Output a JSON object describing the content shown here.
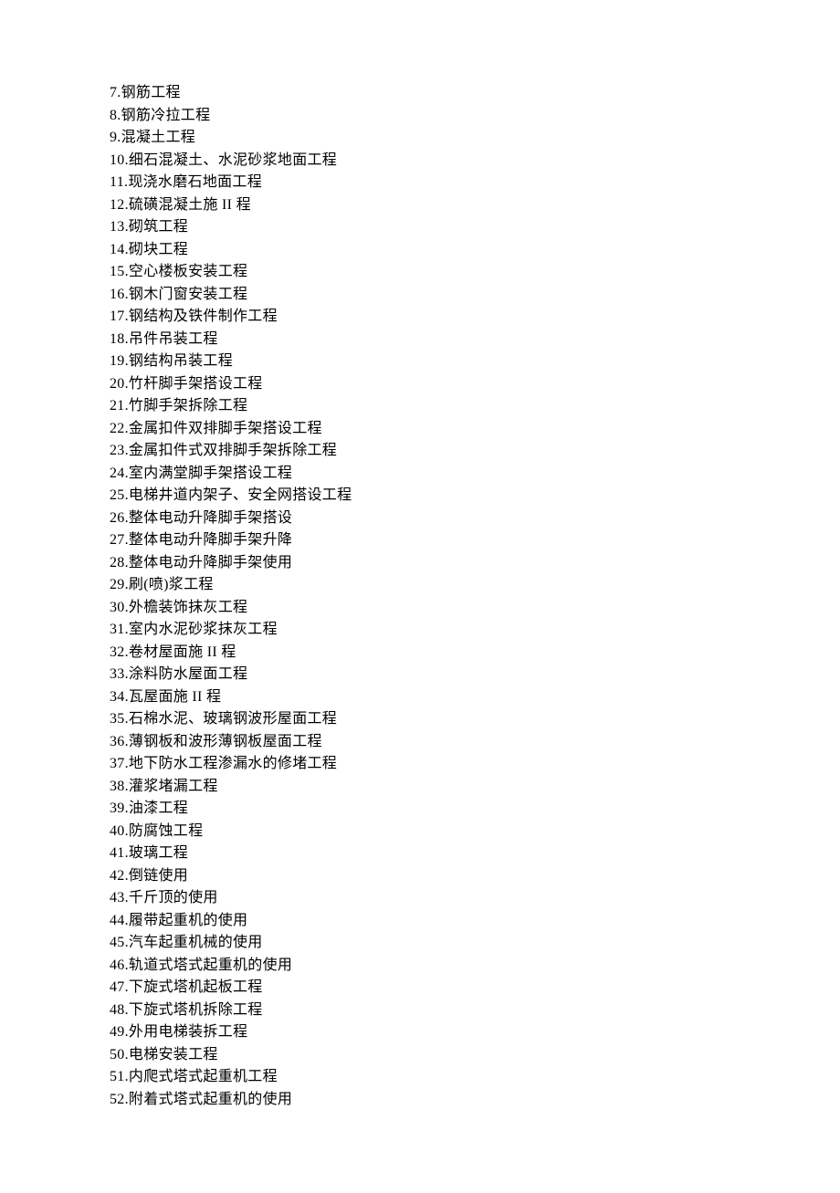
{
  "items": [
    {
      "num": "7.",
      "text": "钢筋工程"
    },
    {
      "num": "8.",
      "text": "钢筋冷拉工程"
    },
    {
      "num": "9.",
      "text": "混凝土工程"
    },
    {
      "num": "10.",
      "text": "细石混凝土、水泥砂浆地面工程"
    },
    {
      "num": "11.",
      "text": "现浇水磨石地面工程"
    },
    {
      "num": "12.",
      "text": "硫磺混凝土施 II 程"
    },
    {
      "num": "13.",
      "text": "砌筑工程"
    },
    {
      "num": "14.",
      "text": "砌块工程"
    },
    {
      "num": "15.",
      "text": "空心楼板安装工程"
    },
    {
      "num": "16.",
      "text": "钢木门窗安装工程"
    },
    {
      "num": "17.",
      "text": "钢结构及铁件制作工程"
    },
    {
      "num": "18.",
      "text": "吊件吊装工程"
    },
    {
      "num": "19.",
      "text": "钢结构吊装工程"
    },
    {
      "num": "20.",
      "text": "竹杆脚手架搭设工程"
    },
    {
      "num": "21.",
      "text": "竹脚手架拆除工程"
    },
    {
      "num": "22.",
      "text": "金属扣件双排脚手架搭设工程"
    },
    {
      "num": "23.",
      "text": "金属扣件式双排脚手架拆除工程"
    },
    {
      "num": "24.",
      "text": "室内满堂脚手架搭设工程"
    },
    {
      "num": "25.",
      "text": "电梯井道内架子、安全网搭设工程"
    },
    {
      "num": "26.",
      "text": "整体电动升降脚手架搭设"
    },
    {
      "num": "27.",
      "text": "整体电动升降脚手架升降"
    },
    {
      "num": "28.",
      "text": "整体电动升降脚手架使用"
    },
    {
      "num": "29.",
      "text": "刷(喷)浆工程"
    },
    {
      "num": "30.",
      "text": "外檐装饰抹灰工程"
    },
    {
      "num": "31.",
      "text": "室内水泥砂浆抹灰工程"
    },
    {
      "num": "32.",
      "text": "卷材屋面施 II 程"
    },
    {
      "num": "33.",
      "text": "涂料防水屋面工程"
    },
    {
      "num": "34.",
      "text": "瓦屋面施 II 程"
    },
    {
      "num": "35.",
      "text": "石棉水泥、玻璃钢波形屋面工程"
    },
    {
      "num": "36.",
      "text": "薄钢板和波形薄钢板屋面工程"
    },
    {
      "num": "37.",
      "text": "地下防水工程渗漏水的修堵工程"
    },
    {
      "num": "38.",
      "text": "灌浆堵漏工程"
    },
    {
      "num": "39.",
      "text": "油漆工程"
    },
    {
      "num": "40.",
      "text": "防腐蚀工程"
    },
    {
      "num": "41.",
      "text": "玻璃工程"
    },
    {
      "num": "42.",
      "text": "倒链使用"
    },
    {
      "num": "43.",
      "text": "千斤顶的使用"
    },
    {
      "num": "44.",
      "text": "履带起重机的使用"
    },
    {
      "num": "45.",
      "text": "汽车起重机械的使用"
    },
    {
      "num": "46.",
      "text": "轨道式塔式起重机的使用"
    },
    {
      "num": "47.",
      "text": "下旋式塔机起板工程"
    },
    {
      "num": "48.",
      "text": "下旋式塔机拆除工程"
    },
    {
      "num": "49.",
      "text": "外用电梯装拆工程"
    },
    {
      "num": "50.",
      "text": "电梯安装工程"
    },
    {
      "num": "51.",
      "text": "内爬式塔式起重机工程"
    },
    {
      "num": "52.",
      "text": "附着式塔式起重机的使用"
    }
  ]
}
